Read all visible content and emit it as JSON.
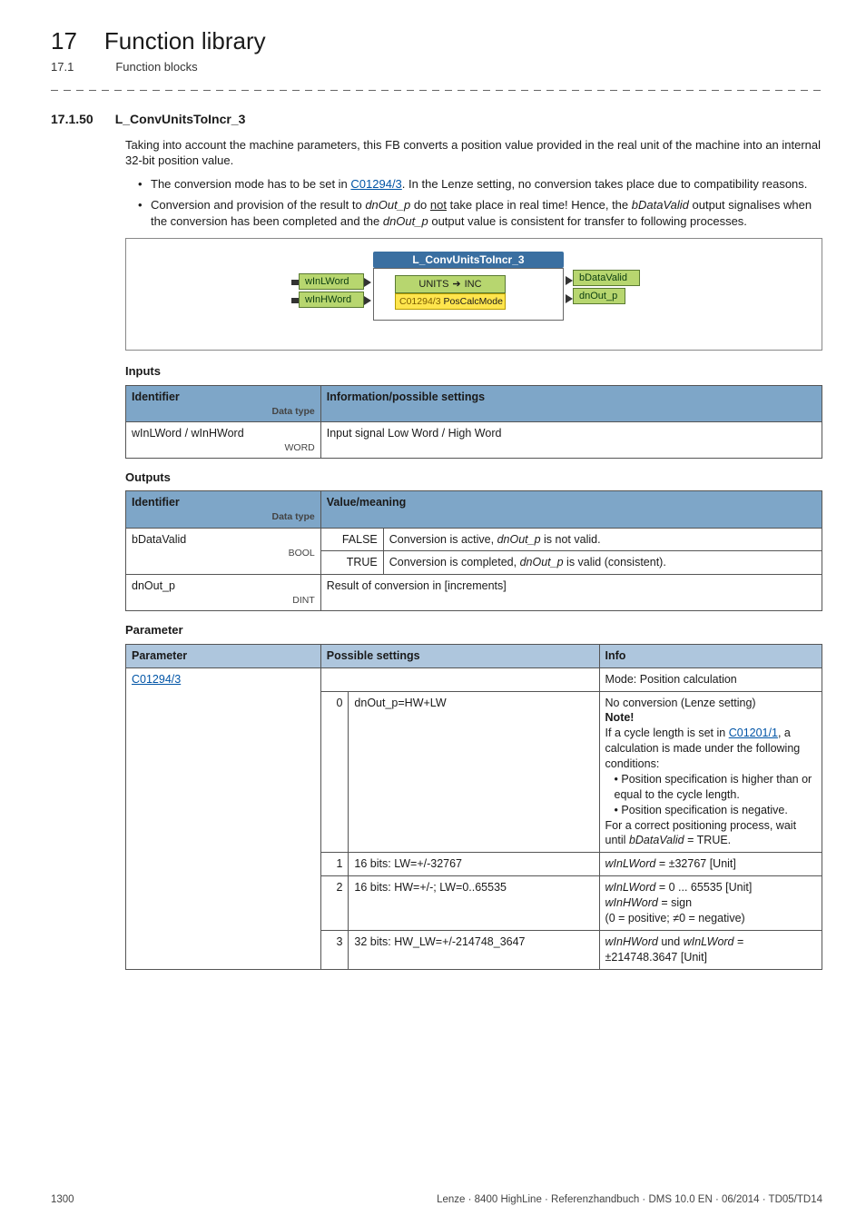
{
  "chapter": {
    "num": "17",
    "title": "Function library"
  },
  "subsection": {
    "num": "17.1",
    "title": "Function blocks"
  },
  "section": {
    "num": "17.1.50",
    "title": "L_ConvUnitsToIncr_3"
  },
  "intro": "Taking into account the machine parameters, this FB converts a position value provided in the real unit of the machine into an internal 32-bit position value.",
  "bullets": {
    "b1a": "The conversion mode has to be set in ",
    "b1_link": "C01294/3",
    "b1b": ". In the Lenze setting, no conversion takes place due to compatibility reasons.",
    "b2a": "Conversion and provision of the result to ",
    "b2_i1": "dnOut_p",
    "b2b": " do ",
    "b2_not": "not",
    "b2c": " take place in real time! Hence, the ",
    "b2_i2": "bDataValid",
    "b2d": " output signalises when the conversion has been completed and the ",
    "b2_i3": "dnOut_p",
    "b2e": " output value is consistent for transfer to following processes."
  },
  "diagram": {
    "title": "L_ConvUnitsToIncr_3",
    "in1": "wInLWord",
    "in2": "wInHWord",
    "units_lhs": "UNITS",
    "units_rhs": "INC",
    "calc_link": "C01294/3",
    "calc_txt": "PosCalcMode",
    "out1": "bDataValid",
    "out2": "dnOut_p"
  },
  "headers": {
    "inputs": "Inputs",
    "outputs": "Outputs",
    "params": "Parameter",
    "identifier": "Identifier",
    "datatype": "Data type",
    "info_in": "Information/possible settings",
    "value": "Value/meaning",
    "param": "Parameter",
    "psettings": "Possible settings",
    "pinfo": "Info"
  },
  "inputs": {
    "row1_id": "wInLWord / wInHWord",
    "row1_dt": "WORD",
    "row1_info": "Input signal Low Word / High Word"
  },
  "outputs": {
    "r1_id": "bDataValid",
    "r1_dt": "BOOL",
    "r1_v1k": "FALSE",
    "r1_v1a": "Conversion is active, ",
    "r1_v1b": "dnOut_p",
    "r1_v1c": " is not valid.",
    "r1_v2k": "TRUE",
    "r1_v2a": "Conversion is completed, ",
    "r1_v2b": "dnOut_p",
    "r1_v2c": " is valid (consistent).",
    "r2_id": "dnOut_p",
    "r2_dt": "DINT",
    "r2_v": "Result of conversion in [increments]"
  },
  "params": {
    "link": "C01294/3",
    "mode": "Mode: Position calculation",
    "r0n": "0",
    "r0s": "dnOut_p=HW+LW",
    "r0i_a": "No conversion (Lenze setting)",
    "r0i_note": "Note!",
    "r0i_b": "If a cycle length is set in ",
    "r0i_link": "C01201/1",
    "r0i_c": ", a calculation is made under the following conditions:",
    "r0i_d": "• Position specification is higher than or equal to the cycle length.",
    "r0i_e": "• Position specification is negative.",
    "r0i_f": "For a correct positioning process, wait until ",
    "r0i_g": "bDataValid",
    "r0i_h": " = TRUE.",
    "r1n": "1",
    "r1s": "16 bits: LW=+/-32767",
    "r1i_a": "wInLWord",
    "r1i_b": " = ±32767 [Unit]",
    "r2n": "2",
    "r2s": "16 bits: HW=+/-; LW=0..65535",
    "r2i_a": "wInLWord",
    "r2i_b": " = 0 ... 65535 [Unit]",
    "r2i_c": "wInHWord",
    "r2i_d": " = sign",
    "r2i_e": "(0 = positive; ≠0 = negative)",
    "r3n": "3",
    "r3s": "32 bits: HW_LW=+/-214748_3647",
    "r3i_a": "wInHWord",
    "r3i_b": " und ",
    "r3i_c": "wInLWord",
    "r3i_d": " = ±214748.3647 [Unit]"
  },
  "footer": {
    "page": "1300",
    "right": "Lenze · 8400 HighLine · Referenzhandbuch · DMS 10.0 EN · 06/2014 · TD05/TD14"
  }
}
